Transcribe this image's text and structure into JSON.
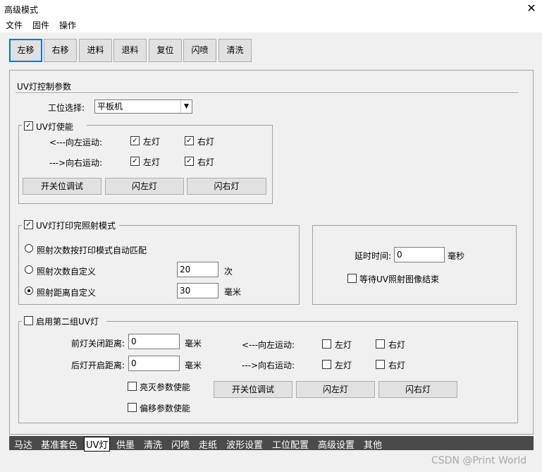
{
  "window": {
    "title": "高级模式"
  },
  "menu": [
    "文件",
    "固件",
    "操作"
  ],
  "toolbar": [
    "左移",
    "右移",
    "进料",
    "退料",
    "复位",
    "闪喷",
    "清洗"
  ],
  "uv_section": {
    "title": "UV灯控制参数",
    "station_label": "工位选择:",
    "station_value": "平板机",
    "enable_group": {
      "title": "UV灯使能",
      "left_move_label": "<---向左运动:",
      "right_move_label": "--->向右运动:",
      "left_lamp": "左灯",
      "right_lamp": "右灯",
      "buttons": [
        "开关位调试",
        "闪左灯",
        "闪右灯"
      ]
    },
    "print_group": {
      "title": "UV灯打印完照射模式",
      "auto_label": "照射次数按打印模式自动匹配",
      "count_label": "照射次数自定义",
      "count_value": "20",
      "count_unit": "次",
      "distance_label": "照射距离自定义",
      "distance_value": "30",
      "distance_unit": "毫米"
    },
    "delay": {
      "label": "延时时间:",
      "value": "0",
      "unit": "毫秒",
      "wait_label": "等待UV照射图像结束"
    },
    "second_group": {
      "title": "启用第二组UV灯",
      "front_off_label": "前灯关闭距离:",
      "front_off_value": "0",
      "rear_on_label": "后灯开启距离:",
      "rear_on_value": "0",
      "unit": "毫米",
      "left_move_label": "<---向左运动:",
      "right_move_label": "--->向右运动:",
      "left_lamp": "左灯",
      "right_lamp": "右灯",
      "on_off_param_label": "亮灭参数使能",
      "offset_param_label": "偏移参数使能",
      "buttons": [
        "开关位调试",
        "闪左灯",
        "闪右灯"
      ]
    }
  },
  "tabs": [
    "马达",
    "基准套色",
    "UV灯",
    "供墨",
    "清洗",
    "闪喷",
    "走纸",
    "波形设置",
    "工位配置",
    "高级设置",
    "其他"
  ],
  "watermark": "CSDN @Print World"
}
